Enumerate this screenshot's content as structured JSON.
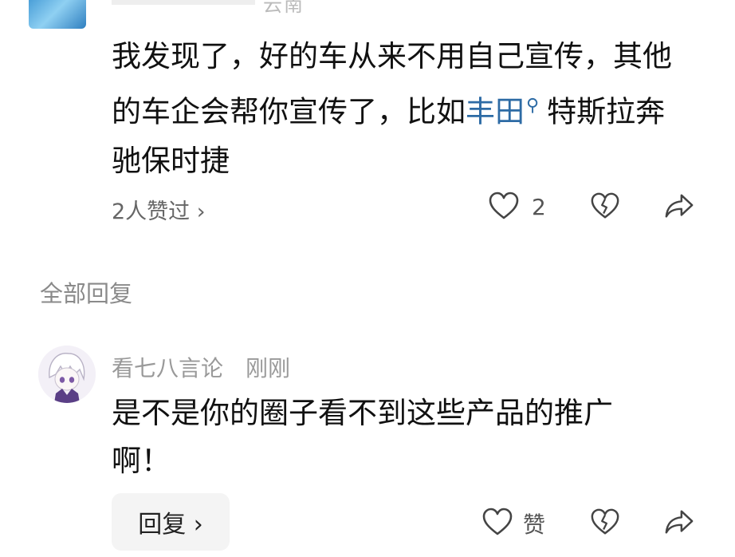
{
  "top_comment": {
    "meta_partial": "云南",
    "text_before_link": "我发现了，好的车从来不用自己宣传，其他的车企会帮你宣传了，比如",
    "link_text": "丰田",
    "text_after_link": "特斯拉奔驰保时捷",
    "likes_summary": "2人赞过 ›",
    "like_count": "2"
  },
  "section": {
    "title": "全部回复"
  },
  "reply": {
    "username": "看七八言论",
    "time": "刚刚",
    "text": "是不是你的圈子看不到这些产品的推广啊！",
    "reply_button_label": "回复 ›",
    "like_label": "赞"
  },
  "colors": {
    "link": "#2d6ba5",
    "secondary_text": "#999999",
    "primary_text": "#111111"
  }
}
